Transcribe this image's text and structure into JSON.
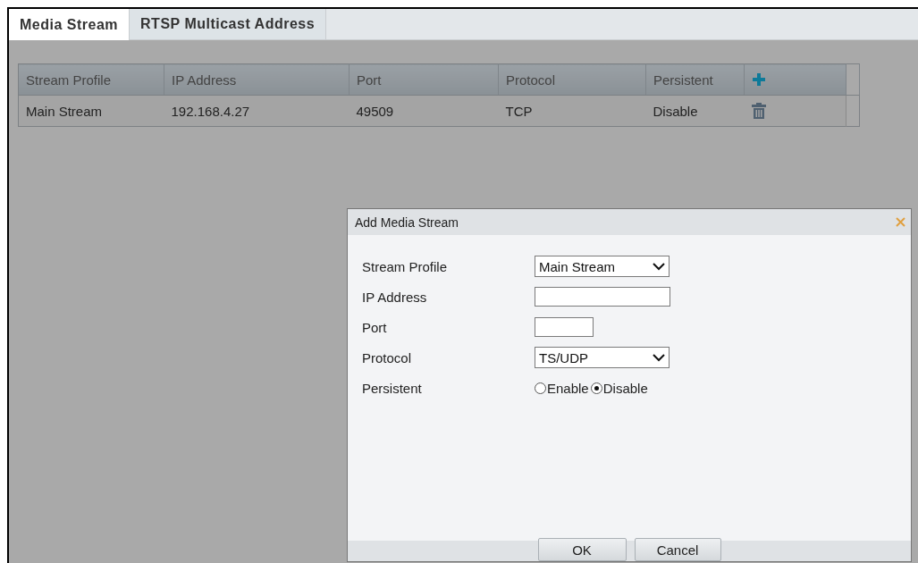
{
  "tabs": [
    {
      "label": "Media Stream",
      "selected": true
    },
    {
      "label": "RTSP Multicast Address",
      "selected": false
    }
  ],
  "table": {
    "columns": [
      "Stream Profile",
      "IP Address",
      "Port",
      "Protocol",
      "Persistent"
    ],
    "rows": [
      {
        "cells": [
          "Main Stream",
          "192.168.4.27",
          "49509",
          "TCP",
          "Disable"
        ]
      }
    ]
  },
  "dialog": {
    "title": "Add Media Stream",
    "fields": [
      {
        "kind": "select",
        "label": "Stream Profile",
        "value": "Main Stream"
      },
      {
        "kind": "text",
        "label": "IP Address"
      },
      {
        "kind": "short",
        "label": "Port"
      },
      {
        "kind": "select",
        "label": "Protocol",
        "value": "TS/UDP"
      },
      {
        "kind": "radio",
        "label": "Persistent",
        "options": [
          {
            "label": "Enable",
            "selected": false
          },
          {
            "label": "Disable",
            "selected": true
          }
        ]
      }
    ],
    "buttons": [
      "OK",
      "Cancel"
    ]
  }
}
